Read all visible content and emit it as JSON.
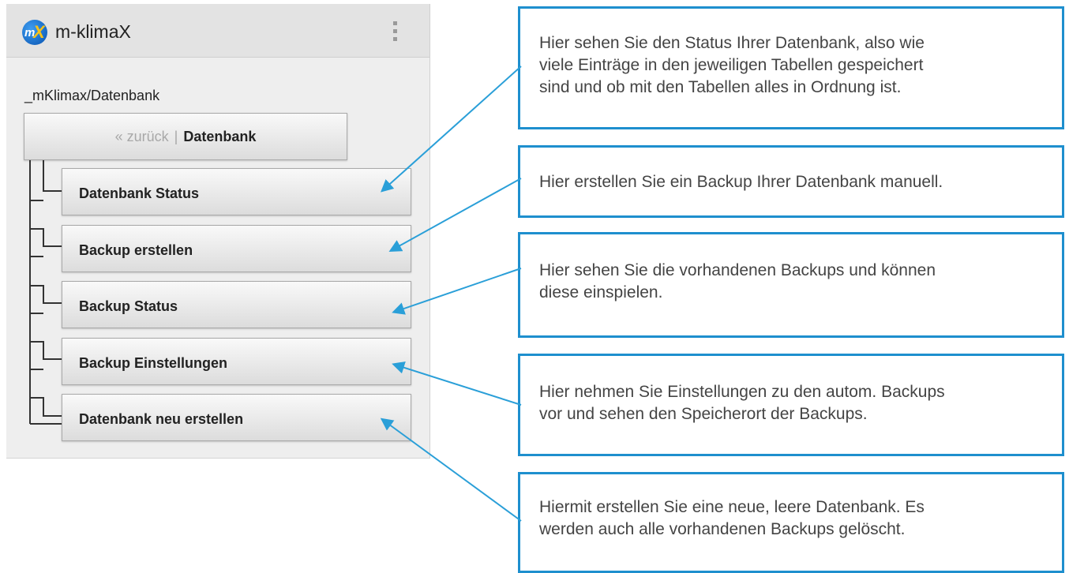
{
  "app": {
    "title": "m-klimaX",
    "logo_text": "mX",
    "path_label": "_mKlimax/Datenbank",
    "back_button": {
      "back_label": "« zurück",
      "separator": "|",
      "current_label": "Datenbank"
    },
    "items": [
      {
        "label": "Datenbank Status"
      },
      {
        "label": "Backup erstellen"
      },
      {
        "label": "Backup Status"
      },
      {
        "label": "Backup Einstellungen"
      },
      {
        "label": "Datenbank neu erstellen"
      }
    ]
  },
  "callouts": [
    {
      "lines": [
        "Hier sehen Sie den Status Ihrer Datenbank, also wie",
        "viele Einträge in den jeweiligen Tabellen gespeichert",
        "sind und ob mit den Tabellen alles in Ordnung ist."
      ]
    },
    {
      "lines": [
        "Hier erstellen Sie ein Backup Ihrer Datenbank manuell."
      ]
    },
    {
      "lines": [
        "Hier sehen Sie die vorhandenen Backups und können",
        "diese einspielen."
      ]
    },
    {
      "lines": [
        "Hier nehmen Sie Einstellungen zu den autom. Backups",
        "vor und sehen den Speicherort der Backups."
      ]
    },
    {
      "lines": [
        "Hiermit erstellen Sie eine neue, leere Datenbank. Es",
        "werden auch alle vorhandenen Backups gelöscht."
      ]
    }
  ],
  "colors": {
    "callout_border": "#1e8fce",
    "arrow": "#2a9fd8",
    "logo_blue": "#1565c0",
    "logo_accent": "#f7c21a"
  }
}
